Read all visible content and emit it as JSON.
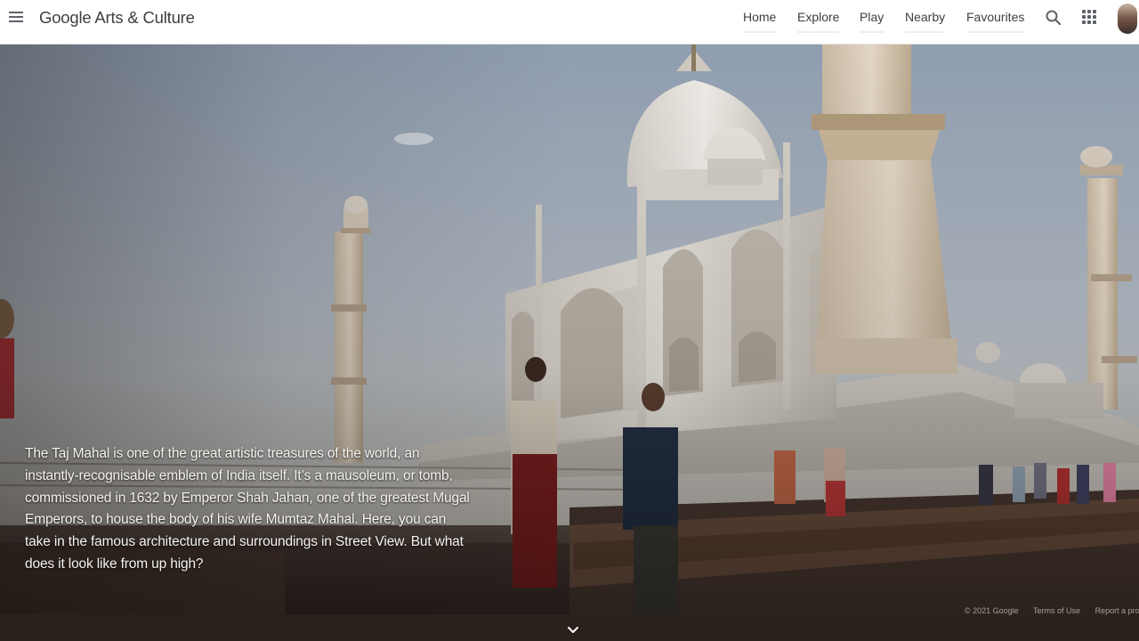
{
  "header": {
    "logo_google": "Google",
    "logo_product": "Arts & Culture",
    "nav": [
      {
        "label": "Home"
      },
      {
        "label": "Explore"
      },
      {
        "label": "Play"
      },
      {
        "label": "Nearby"
      },
      {
        "label": "Favourites"
      }
    ],
    "icons": [
      "menu-icon",
      "search-icon",
      "apps-grid-icon",
      "avatar"
    ]
  },
  "hero": {
    "image_subject": "Taj Mahal",
    "description_lines": [
      "The Taj Mahal is one of the great artistic treasures of the world, an",
      "instantly-recognisable emblem of India itself. It’s a mausoleum, or tomb,",
      "commissioned in 1632 by Emperor Shah Jahan, one of the greatest Mugal",
      "Emperors, to house the body of his wife Mumtaz Mahal. Here, you can",
      "take in the famous architecture and surroundings in Street View. But what",
      "does it look like from up high?"
    ],
    "credit": {
      "copyright": "© 2021 Google",
      "terms": "Terms of Use",
      "report": "Report a problem"
    },
    "scroll_icon": "chevron-down-icon"
  },
  "colors": {
    "header_bg": "#ffffff",
    "nav_text": "#3c4043",
    "icon_gray": "#5f6368",
    "hero_text": "#f6f3ee"
  }
}
